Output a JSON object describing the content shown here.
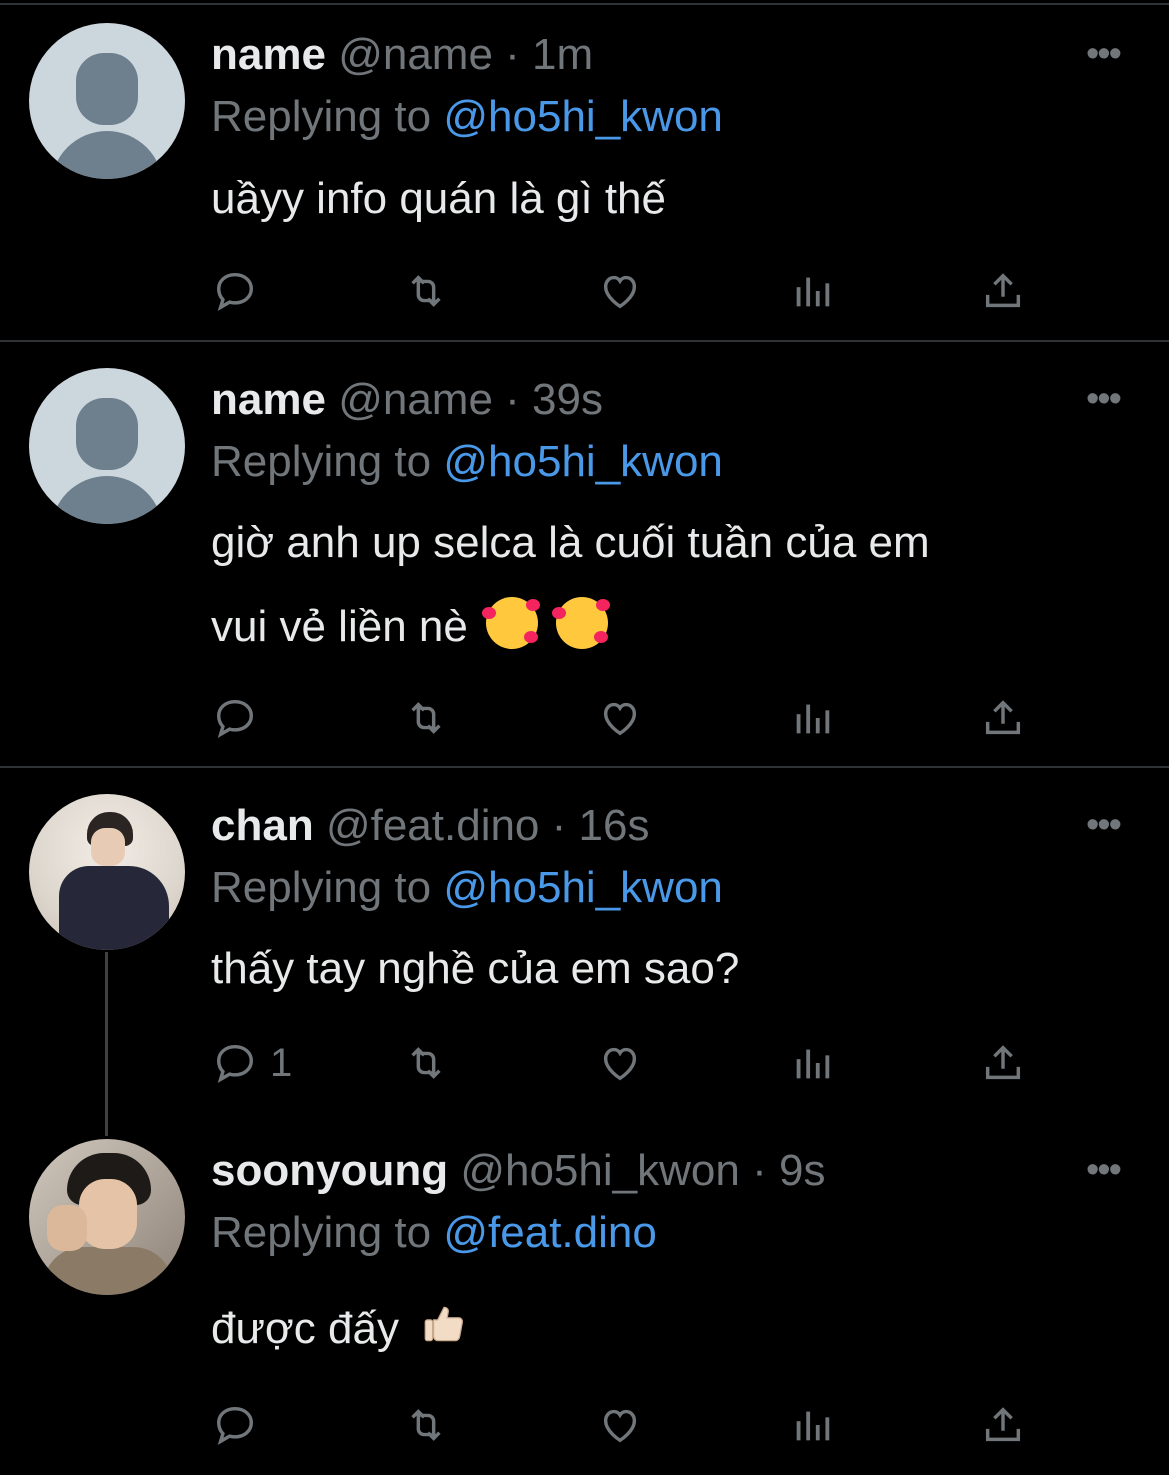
{
  "tweets": [
    {
      "name": "name",
      "handle": "@name",
      "sep": "·",
      "time": "1m",
      "replying_label": "Replying to",
      "replying_to": "@ho5hi_kwon",
      "text": "uầyy info quán là gì thế",
      "more": "•••",
      "reply_count": ""
    },
    {
      "name": "name",
      "handle": "@name",
      "sep": "·",
      "time": "39s",
      "replying_label": "Replying to",
      "replying_to": "@ho5hi_kwon",
      "text_line1": "giờ anh up selca là cuối tuần của em",
      "text_line2": "vui vẻ liền nè",
      "emojis": [
        "smiling-face-with-hearts",
        "smiling-face-with-hearts"
      ],
      "more": "•••",
      "reply_count": ""
    },
    {
      "name": "chan",
      "handle": "@feat.dino",
      "sep": "·",
      "time": "16s",
      "replying_label": "Replying to",
      "replying_to": "@ho5hi_kwon",
      "text": "thấy tay nghề của em sao?",
      "more": "•••",
      "reply_count": "1"
    },
    {
      "name": "soonyoung",
      "handle": "@ho5hi_kwon",
      "sep": "·",
      "time": "9s",
      "replying_label": "Replying to",
      "replying_to": "@feat.dino",
      "text": "được đấy",
      "emojis": [
        "thumbs-up"
      ],
      "more": "•••",
      "reply_count": ""
    }
  ],
  "icons": [
    "reply-icon",
    "retweet-icon",
    "like-icon",
    "analytics-icon",
    "share-icon"
  ],
  "colors": {
    "background": "#000000",
    "text": "#e7e9ea",
    "muted": "#71767b",
    "link": "#4a99e9",
    "divider": "#2f3336"
  }
}
